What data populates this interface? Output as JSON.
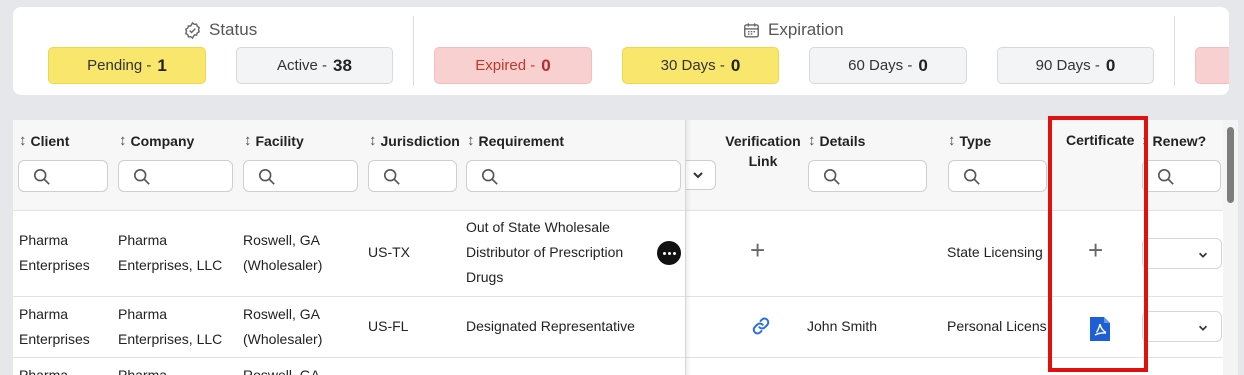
{
  "summary": {
    "status": {
      "title": "Status",
      "icon": "badge-check-icon",
      "pills": [
        {
          "label": "Pending -",
          "count": "1",
          "color": "#f8e76c"
        },
        {
          "label": "Active -",
          "count": "38",
          "color": "#f3f4f6"
        }
      ]
    },
    "expiration": {
      "title": "Expiration",
      "icon": "calendar-icon",
      "pills": [
        {
          "label": "Expired -",
          "count": "0",
          "color": "#f8d0d0"
        },
        {
          "label": "30 Days -",
          "count": "0",
          "color": "#f8e76c"
        },
        {
          "label": "60 Days -",
          "count": "0",
          "color": "#f3f4f6"
        },
        {
          "label": "90 Days -",
          "count": "0",
          "color": "#f3f4f6"
        }
      ]
    }
  },
  "table": {
    "columns": {
      "client": "Client",
      "company": "Company",
      "facility": "Facility",
      "jurisdiction": "Jurisdiction",
      "requirement": "Requirement",
      "verification_1": "Verification",
      "verification_2": "Link",
      "details": "Details",
      "type": "Type",
      "certificate": "Certificate",
      "renew": "Renew?"
    },
    "rows": [
      {
        "client": [
          "Pharma",
          "Enterprises"
        ],
        "company": [
          "Pharma",
          "Enterprises, LLC"
        ],
        "facility": [
          "Roswell, GA",
          "(Wholesaler)"
        ],
        "jurisdiction": "US-TX",
        "requirement": [
          "Out of State Wholesale",
          "Distributor of Prescription",
          "Drugs"
        ],
        "verification": "add-icon",
        "details": "",
        "type": "State Licensing",
        "certificate": "add-icon"
      },
      {
        "client": [
          "Pharma",
          "Enterprises"
        ],
        "company": [
          "Pharma",
          "Enterprises, LLC"
        ],
        "facility": [
          "Roswell, GA",
          "(Wholesaler)"
        ],
        "jurisdiction": "US-FL",
        "requirement": [
          "Designated Representative"
        ],
        "verification": "link-icon",
        "details": "John Smith",
        "type": "Personal License",
        "certificate": "pdf-file-icon"
      },
      {
        "client": [
          "Pharma"
        ],
        "company": [
          "Pharma"
        ],
        "facility": [
          "Roswell, GA"
        ]
      }
    ]
  },
  "colors": {
    "highlight": "#e01010",
    "link": "#2a6fdb",
    "pdf": "#1f5fd6"
  }
}
